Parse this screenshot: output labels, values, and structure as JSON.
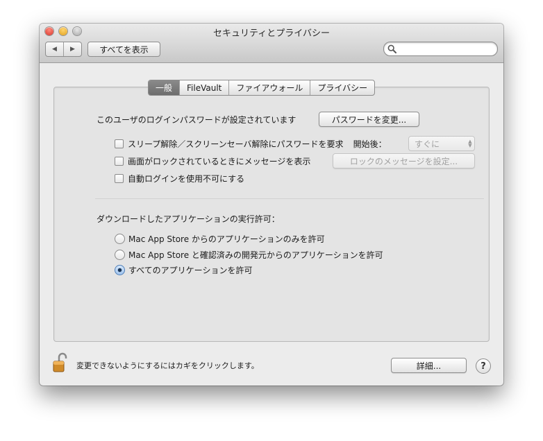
{
  "window": {
    "title": "セキュリティとプライバシー"
  },
  "toolbar": {
    "back_label": "◀",
    "forward_label": "▶",
    "show_all_label": "すべてを表示",
    "search_placeholder": "",
    "search_icon": "magnifier-icon"
  },
  "tabs": [
    "一般",
    "FileVault",
    "ファイアウォール",
    "プライバシー"
  ],
  "selected_tab": "一般",
  "general": {
    "password_text": "このユーザのログインパスワードが設定されています",
    "change_password_label": "パスワードを変更...",
    "require_password_label": "スリープ解除／スクリーンセーバ解除にパスワードを要求",
    "require_password_checked": false,
    "delay_label": "開始後：",
    "delay_value": "すぐに",
    "show_message_label": "画面がロックされているときにメッセージを表示",
    "show_message_checked": false,
    "set_message_label": "ロックのメッセージを設定...",
    "disable_autologin_label": "自動ログインを使用不可にする",
    "disable_autologin_checked": false
  },
  "downloads": {
    "heading": "ダウンロードしたアプリケーションの実行許可：",
    "options": [
      {
        "label": "Mac App Store からのアプリケーションのみを許可",
        "selected": false
      },
      {
        "label": "Mac App Store と確認済みの開発元からのアプリケーションを許可",
        "selected": false
      },
      {
        "label": "すべてのアプリケーションを許可",
        "selected": true
      }
    ]
  },
  "footer": {
    "lock_icon": "unlocked-padlock-icon",
    "lock_text": "変更できないようにするにはカギをクリックします。",
    "advanced_label": "詳細...",
    "help_label": "?"
  },
  "colors": {
    "selected_tab": "#7a7a7a",
    "window_bg": "#ececec",
    "radio_selected": "#9fc3ee"
  }
}
